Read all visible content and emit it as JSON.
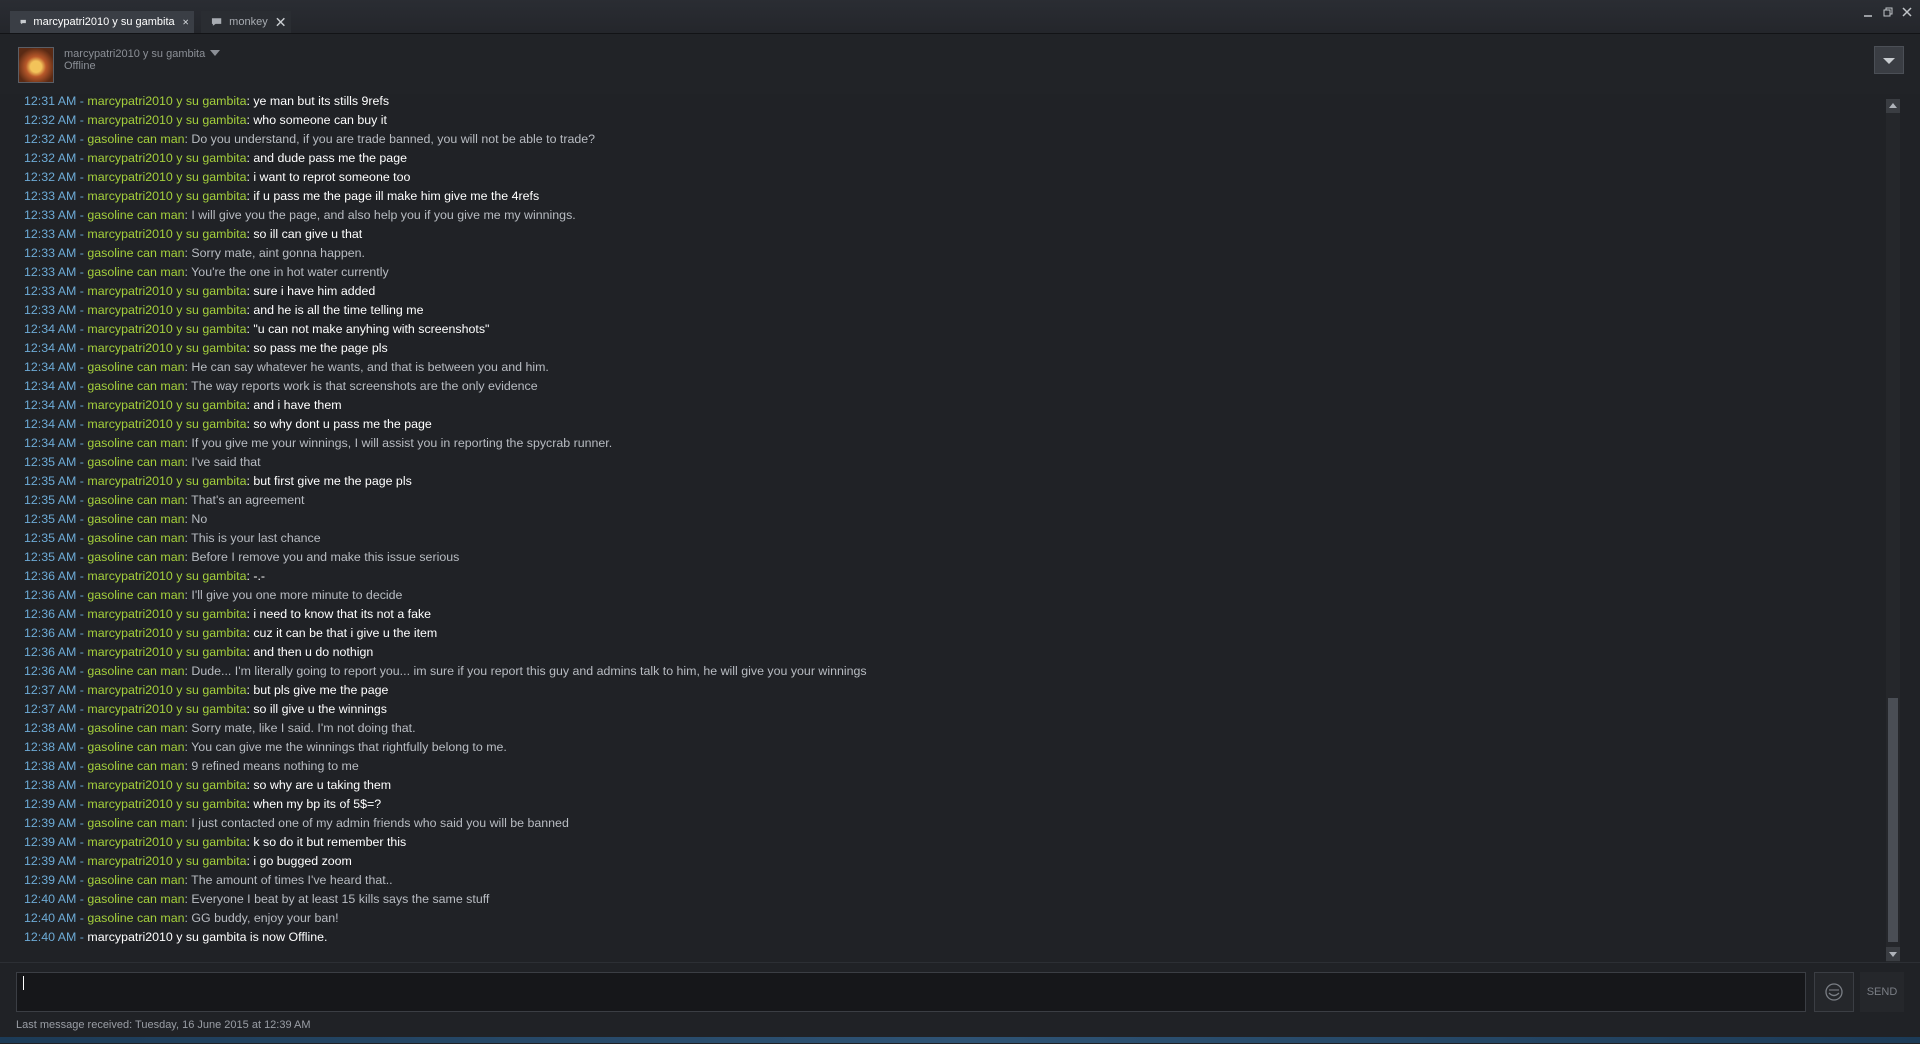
{
  "tabs": [
    {
      "label": "marcypatri2010 y su gambita",
      "active": true
    },
    {
      "label": "monkey",
      "active": false
    }
  ],
  "friend": {
    "name": "marcypatri2010 y su gambita",
    "status": "Offline"
  },
  "colors": {
    "timestamp": "#6dabd6",
    "name": "#a4cf3c",
    "their_message": "#ffffff",
    "my_message": "#b8bcc2"
  },
  "messages": [
    {
      "time": "12:31 AM",
      "name": "marcypatri2010 y su gambita",
      "text": "ye man but its stills 9refs",
      "who": "them"
    },
    {
      "time": "12:32 AM",
      "name": "marcypatri2010 y su gambita",
      "text": "who someone can buy it",
      "who": "them"
    },
    {
      "time": "12:32 AM",
      "name": "gasoline can man",
      "text": "Do you understand, if you are trade banned, you will not be able to trade?",
      "who": "me"
    },
    {
      "time": "12:32 AM",
      "name": "marcypatri2010 y su gambita",
      "text": "and dude pass me the page",
      "who": "them"
    },
    {
      "time": "12:32 AM",
      "name": "marcypatri2010 y su gambita",
      "text": "i want to reprot someone too",
      "who": "them"
    },
    {
      "time": "12:33 AM",
      "name": "marcypatri2010 y su gambita",
      "text": "if u pass me the page ill make him give me the 4refs",
      "who": "them"
    },
    {
      "time": "12:33 AM",
      "name": "gasoline can man",
      "text": "I will give you the page, and also help you if you give me my winnings.",
      "who": "me"
    },
    {
      "time": "12:33 AM",
      "name": "marcypatri2010 y su gambita",
      "text": "so ill can give u that",
      "who": "them"
    },
    {
      "time": "12:33 AM",
      "name": "gasoline can man",
      "text": "Sorry mate, aint gonna happen.",
      "who": "me"
    },
    {
      "time": "12:33 AM",
      "name": "gasoline can man",
      "text": "You're the one in hot water currently",
      "who": "me"
    },
    {
      "time": "12:33 AM",
      "name": "marcypatri2010 y su gambita",
      "text": "sure i have him added",
      "who": "them"
    },
    {
      "time": "12:33 AM",
      "name": "marcypatri2010 y su gambita",
      "text": "and he is all the time telling me",
      "who": "them"
    },
    {
      "time": "12:34 AM",
      "name": "marcypatri2010 y su gambita",
      "text": "\"u can not make anyhing with screenshots\"",
      "who": "them"
    },
    {
      "time": "12:34 AM",
      "name": "marcypatri2010 y su gambita",
      "text": "so pass me the page pls",
      "who": "them"
    },
    {
      "time": "12:34 AM",
      "name": "gasoline can man",
      "text": "He can say whatever he wants, and that is between you and him.",
      "who": "me"
    },
    {
      "time": "12:34 AM",
      "name": "gasoline can man",
      "text": "The way reports work is that screenshots are the only evidence",
      "who": "me"
    },
    {
      "time": "12:34 AM",
      "name": "marcypatri2010 y su gambita",
      "text": "and i have them",
      "who": "them"
    },
    {
      "time": "12:34 AM",
      "name": "marcypatri2010 y su gambita",
      "text": "so why dont u pass me the page",
      "who": "them"
    },
    {
      "time": "12:34 AM",
      "name": "gasoline can man",
      "text": "If you give me your winnings, I will assist you in reporting the spycrab runner.",
      "who": "me"
    },
    {
      "time": "12:35 AM",
      "name": "gasoline can man",
      "text": "I've said that",
      "who": "me"
    },
    {
      "time": "12:35 AM",
      "name": "marcypatri2010 y su gambita",
      "text": "but first give me the page pls",
      "who": "them"
    },
    {
      "time": "12:35 AM",
      "name": "gasoline can man",
      "text": "That's an agreement",
      "who": "me"
    },
    {
      "time": "12:35 AM",
      "name": "gasoline can man",
      "text": "No",
      "who": "me"
    },
    {
      "time": "12:35 AM",
      "name": "gasoline can man",
      "text": "This is your last chance",
      "who": "me"
    },
    {
      "time": "12:35 AM",
      "name": "gasoline can man",
      "text": "Before I remove you and make this issue serious",
      "who": "me"
    },
    {
      "time": "12:36 AM",
      "name": "marcypatri2010 y su gambita",
      "text": "-.-",
      "who": "them"
    },
    {
      "time": "12:36 AM",
      "name": "gasoline can man",
      "text": "I'll give you one more minute to decide",
      "who": "me"
    },
    {
      "time": "12:36 AM",
      "name": "marcypatri2010 y su gambita",
      "text": "i need to know that its not a fake",
      "who": "them"
    },
    {
      "time": "12:36 AM",
      "name": "marcypatri2010 y su gambita",
      "text": "cuz it can be that i give u the item",
      "who": "them"
    },
    {
      "time": "12:36 AM",
      "name": "marcypatri2010 y su gambita",
      "text": "and then u do nothign",
      "who": "them"
    },
    {
      "time": "12:36 AM",
      "name": "gasoline can man",
      "text": "Dude... I'm literally going to report you... im sure if you report this guy and admins talk to him, he will give you your winnings",
      "who": "me"
    },
    {
      "time": "12:37 AM",
      "name": "marcypatri2010 y su gambita",
      "text": "but pls give me the page",
      "who": "them"
    },
    {
      "time": "12:37 AM",
      "name": "marcypatri2010 y su gambita",
      "text": "so ill give u the winnings",
      "who": "them"
    },
    {
      "time": "12:38 AM",
      "name": "gasoline can man",
      "text": "Sorry mate, like I said. I'm not doing that.",
      "who": "me"
    },
    {
      "time": "12:38 AM",
      "name": "gasoline can man",
      "text": "You can give me the winnings that rightfully belong to me.",
      "who": "me"
    },
    {
      "time": "12:38 AM",
      "name": "gasoline can man",
      "text": "9 refined means nothing to me",
      "who": "me"
    },
    {
      "time": "12:38 AM",
      "name": "marcypatri2010 y su gambita",
      "text": "so why are u taking them",
      "who": "them"
    },
    {
      "time": "12:39 AM",
      "name": "marcypatri2010 y su gambita",
      "text": "when my bp its of 5$=?",
      "who": "them"
    },
    {
      "time": "12:39 AM",
      "name": "gasoline can man",
      "text": "I just contacted one of my admin friends who said you will be banned",
      "who": "me"
    },
    {
      "time": "12:39 AM",
      "name": "marcypatri2010 y su gambita",
      "text": "k so do it but remember this",
      "who": "them"
    },
    {
      "time": "12:39 AM",
      "name": "marcypatri2010 y su gambita",
      "text": "i go bugged zoom",
      "who": "them"
    },
    {
      "time": "12:39 AM",
      "name": "gasoline can man",
      "text": "The amount of times I've heard that..",
      "who": "me"
    },
    {
      "time": "12:40 AM",
      "name": "gasoline can man",
      "text": "Everyone I beat by at least 15 kills says the same stuff",
      "who": "me"
    },
    {
      "time": "12:40 AM",
      "name": "gasoline can man",
      "text": "GG buddy, enjoy your ban!",
      "who": "me"
    }
  ],
  "status_line": {
    "time": "12:40 AM",
    "text": "marcypatri2010 y su gambita is now Offline."
  },
  "separator": " - ",
  "separator_colon": ": ",
  "input": {
    "value": "",
    "placeholder": ""
  },
  "send_label": "SEND",
  "footer": "Last message received: Tuesday, 16 June 2015 at 12:39 AM"
}
